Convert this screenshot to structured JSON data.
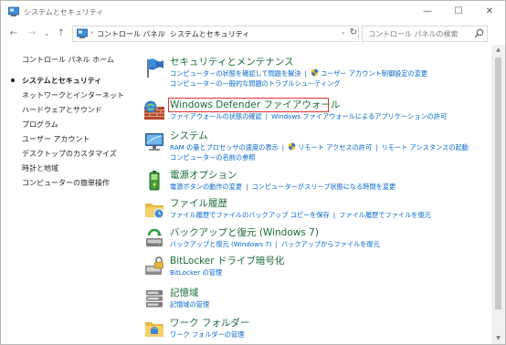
{
  "window": {
    "title": "システムとセキュリティ",
    "controls": {
      "minimize": "—",
      "maximize": "☐",
      "close": "✕"
    }
  },
  "nav": {
    "back": "←",
    "forward": "→",
    "recent": "⌄",
    "up": "↑",
    "breadcrumb": [
      "コントロール パネル",
      "システムとセキュリティ"
    ],
    "search_placeholder": "コントロール パネルの検索"
  },
  "sidebar": {
    "items": [
      {
        "label": "コントロール パネル ホーム",
        "current": false
      },
      {
        "label": "システムとセキュリティ",
        "current": true
      },
      {
        "label": "ネットワークとインターネット",
        "current": false
      },
      {
        "label": "ハードウェアとサウンド",
        "current": false
      },
      {
        "label": "プログラム",
        "current": false
      },
      {
        "label": "ユーザー アカウント",
        "current": false
      },
      {
        "label": "デスクトップのカスタマイズ",
        "current": false
      },
      {
        "label": "時計と地域",
        "current": false
      },
      {
        "label": "コンピューターの簡単操作",
        "current": false
      }
    ]
  },
  "categories": [
    {
      "title": "セキュリティとメンテナンス",
      "links_line1": [
        "コンピューターの状態を確認して問題を解決",
        "ユーザー アカウント制御設定の変更"
      ],
      "links_line2": [
        "コンピューターの一般的な問題のトラブルシューティング"
      ]
    },
    {
      "title": "Windows Defender ファイアウォール",
      "links_line1": [
        "ファイアウォールの状態の確認",
        "Windows ファイアウォールによるアプリケーションの許可"
      ]
    },
    {
      "title": "システム",
      "links_line1": [
        "RAM の量とプロセッサの速度の表示",
        "リモート アクセスの許可",
        "リモート アシスタンスの起動"
      ],
      "links_line2": [
        "コンピューターの名前の参照"
      ]
    },
    {
      "title": "電源オプション",
      "links_line1": [
        "電源ボタンの動作の変更",
        "コンピューターがスリープ状態になる時間を変更"
      ]
    },
    {
      "title": "ファイル履歴",
      "links_line1": [
        "ファイル履歴でファイルのバックアップ コピーを保存",
        "ファイル履歴でファイルを復元"
      ]
    },
    {
      "title": "バックアップと復元 (Windows 7)",
      "links_line1": [
        "バックアップと復元 (Windows 7)",
        "バックアップからファイルを復元"
      ]
    },
    {
      "title": "BitLocker ドライブ暗号化",
      "links_line1": [
        "BitLocker の管理"
      ]
    },
    {
      "title": "記憶域",
      "links_line1": [
        "記憶域の管理"
      ]
    },
    {
      "title": "ワーク フォルダー",
      "links_line1": [
        "ワーク フォルダーの管理"
      ]
    }
  ],
  "colors": {
    "category_title": "#1b6d35",
    "link": "#0066cc",
    "highlight_border": "#e03030"
  },
  "icons": [
    "control-panel-icon",
    "flag-icon",
    "firewall-brick-icon",
    "monitor-icon",
    "battery-icon",
    "folder-clock-icon",
    "backup-icon",
    "drive-lock-icon",
    "storage-icon",
    "work-folder-icon",
    "shield-uac-icon",
    "search-icon",
    "refresh-icon"
  ]
}
